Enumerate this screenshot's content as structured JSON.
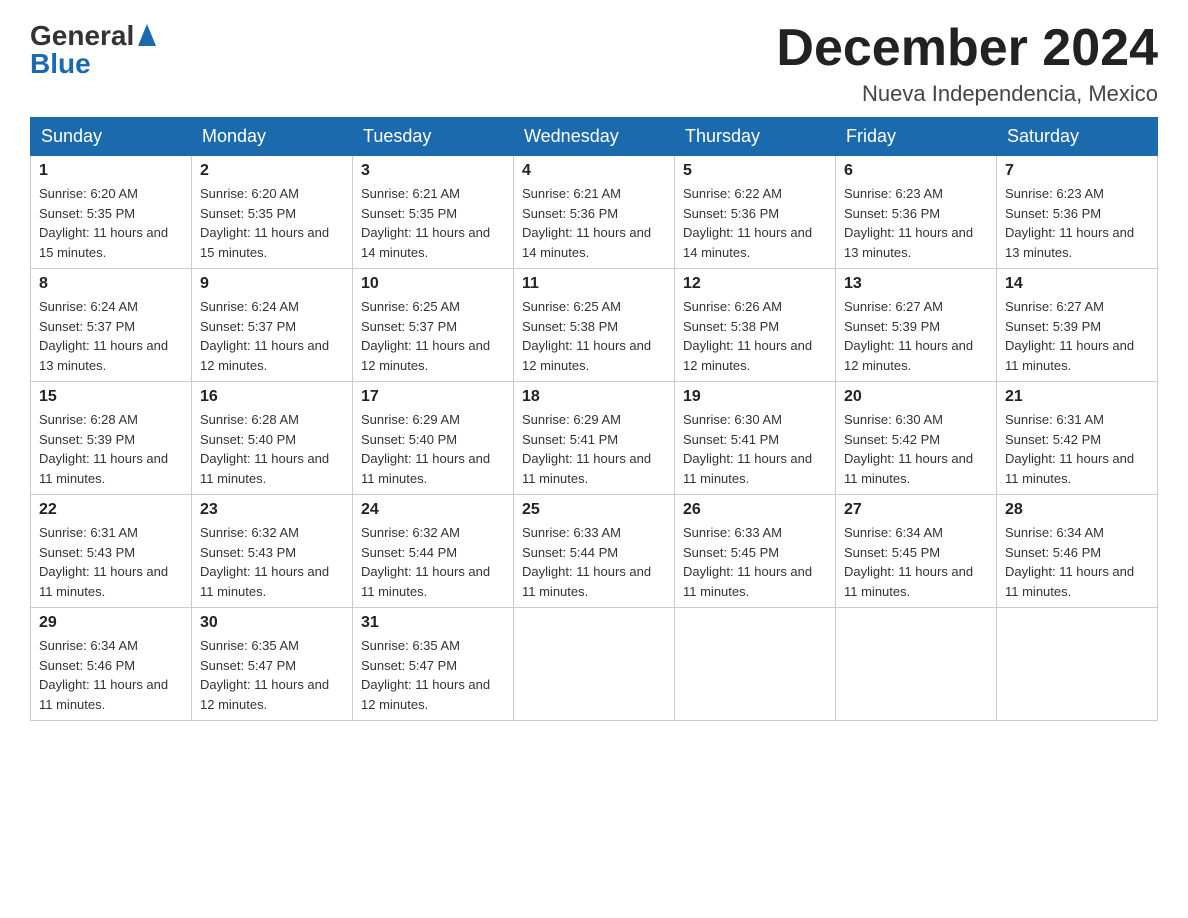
{
  "logo": {
    "text_general": "General",
    "text_blue": "Blue"
  },
  "header": {
    "title": "December 2024",
    "location": "Nueva Independencia, Mexico"
  },
  "days_of_week": [
    "Sunday",
    "Monday",
    "Tuesday",
    "Wednesday",
    "Thursday",
    "Friday",
    "Saturday"
  ],
  "weeks": [
    [
      {
        "day": "1",
        "sunrise": "6:20 AM",
        "sunset": "5:35 PM",
        "daylight": "11 hours and 15 minutes."
      },
      {
        "day": "2",
        "sunrise": "6:20 AM",
        "sunset": "5:35 PM",
        "daylight": "11 hours and 15 minutes."
      },
      {
        "day": "3",
        "sunrise": "6:21 AM",
        "sunset": "5:35 PM",
        "daylight": "11 hours and 14 minutes."
      },
      {
        "day": "4",
        "sunrise": "6:21 AM",
        "sunset": "5:36 PM",
        "daylight": "11 hours and 14 minutes."
      },
      {
        "day": "5",
        "sunrise": "6:22 AM",
        "sunset": "5:36 PM",
        "daylight": "11 hours and 14 minutes."
      },
      {
        "day": "6",
        "sunrise": "6:23 AM",
        "sunset": "5:36 PM",
        "daylight": "11 hours and 13 minutes."
      },
      {
        "day": "7",
        "sunrise": "6:23 AM",
        "sunset": "5:36 PM",
        "daylight": "11 hours and 13 minutes."
      }
    ],
    [
      {
        "day": "8",
        "sunrise": "6:24 AM",
        "sunset": "5:37 PM",
        "daylight": "11 hours and 13 minutes."
      },
      {
        "day": "9",
        "sunrise": "6:24 AM",
        "sunset": "5:37 PM",
        "daylight": "11 hours and 12 minutes."
      },
      {
        "day": "10",
        "sunrise": "6:25 AM",
        "sunset": "5:37 PM",
        "daylight": "11 hours and 12 minutes."
      },
      {
        "day": "11",
        "sunrise": "6:25 AM",
        "sunset": "5:38 PM",
        "daylight": "11 hours and 12 minutes."
      },
      {
        "day": "12",
        "sunrise": "6:26 AM",
        "sunset": "5:38 PM",
        "daylight": "11 hours and 12 minutes."
      },
      {
        "day": "13",
        "sunrise": "6:27 AM",
        "sunset": "5:39 PM",
        "daylight": "11 hours and 12 minutes."
      },
      {
        "day": "14",
        "sunrise": "6:27 AM",
        "sunset": "5:39 PM",
        "daylight": "11 hours and 11 minutes."
      }
    ],
    [
      {
        "day": "15",
        "sunrise": "6:28 AM",
        "sunset": "5:39 PM",
        "daylight": "11 hours and 11 minutes."
      },
      {
        "day": "16",
        "sunrise": "6:28 AM",
        "sunset": "5:40 PM",
        "daylight": "11 hours and 11 minutes."
      },
      {
        "day": "17",
        "sunrise": "6:29 AM",
        "sunset": "5:40 PM",
        "daylight": "11 hours and 11 minutes."
      },
      {
        "day": "18",
        "sunrise": "6:29 AM",
        "sunset": "5:41 PM",
        "daylight": "11 hours and 11 minutes."
      },
      {
        "day": "19",
        "sunrise": "6:30 AM",
        "sunset": "5:41 PM",
        "daylight": "11 hours and 11 minutes."
      },
      {
        "day": "20",
        "sunrise": "6:30 AM",
        "sunset": "5:42 PM",
        "daylight": "11 hours and 11 minutes."
      },
      {
        "day": "21",
        "sunrise": "6:31 AM",
        "sunset": "5:42 PM",
        "daylight": "11 hours and 11 minutes."
      }
    ],
    [
      {
        "day": "22",
        "sunrise": "6:31 AM",
        "sunset": "5:43 PM",
        "daylight": "11 hours and 11 minutes."
      },
      {
        "day": "23",
        "sunrise": "6:32 AM",
        "sunset": "5:43 PM",
        "daylight": "11 hours and 11 minutes."
      },
      {
        "day": "24",
        "sunrise": "6:32 AM",
        "sunset": "5:44 PM",
        "daylight": "11 hours and 11 minutes."
      },
      {
        "day": "25",
        "sunrise": "6:33 AM",
        "sunset": "5:44 PM",
        "daylight": "11 hours and 11 minutes."
      },
      {
        "day": "26",
        "sunrise": "6:33 AM",
        "sunset": "5:45 PM",
        "daylight": "11 hours and 11 minutes."
      },
      {
        "day": "27",
        "sunrise": "6:34 AM",
        "sunset": "5:45 PM",
        "daylight": "11 hours and 11 minutes."
      },
      {
        "day": "28",
        "sunrise": "6:34 AM",
        "sunset": "5:46 PM",
        "daylight": "11 hours and 11 minutes."
      }
    ],
    [
      {
        "day": "29",
        "sunrise": "6:34 AM",
        "sunset": "5:46 PM",
        "daylight": "11 hours and 11 minutes."
      },
      {
        "day": "30",
        "sunrise": "6:35 AM",
        "sunset": "5:47 PM",
        "daylight": "11 hours and 12 minutes."
      },
      {
        "day": "31",
        "sunrise": "6:35 AM",
        "sunset": "5:47 PM",
        "daylight": "11 hours and 12 minutes."
      },
      null,
      null,
      null,
      null
    ]
  ],
  "labels": {
    "sunrise": "Sunrise:",
    "sunset": "Sunset:",
    "daylight": "Daylight:"
  }
}
